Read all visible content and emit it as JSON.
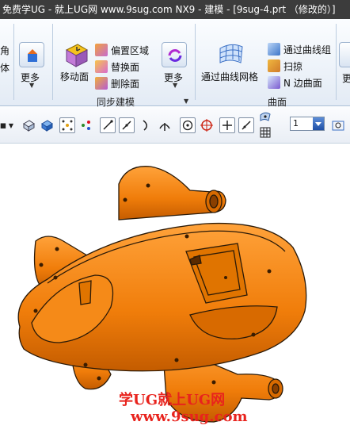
{
  "window": {
    "title": "免费学UG - 就上UG网 www.9sug.com NX9 - 建模 - [9sug-4.prt （修改的）]"
  },
  "ribbon": {
    "cut_left_top": "角",
    "cut_left_bottom": "体",
    "more_label": "更多",
    "move_face_label": "移动面",
    "offset_region_label": "偏置区域",
    "replace_face_label": "替换面",
    "delete_face_label": "删除面",
    "more2_label": "更多",
    "sync_group_label": "同步建模",
    "through_curve_mesh_label": "通过曲线网格",
    "through_curves_label": "通过曲线组",
    "sweep_label": "扫掠",
    "n_side_label": "N 边曲面",
    "surface_group_label": "曲面",
    "cut_right_label": "更"
  },
  "toolbar": {
    "zoom_value": "1"
  },
  "viewport": {
    "model_color": "#f07d0a",
    "watermark_line1": "学UG就上UG网",
    "watermark_line2": "www.9sug.com"
  }
}
